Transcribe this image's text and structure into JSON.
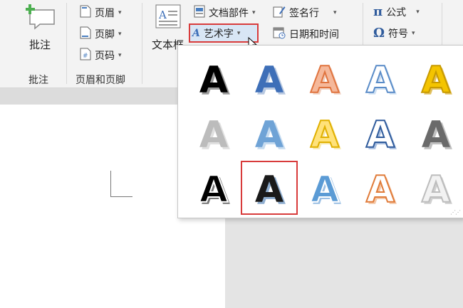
{
  "ribbon": {
    "comment_group": {
      "button_label": "批注",
      "group_label": "批注"
    },
    "header_footer_group": {
      "items": [
        {
          "label": "页眉",
          "icon": "page-header-icon"
        },
        {
          "label": "页脚",
          "icon": "page-footer-icon"
        },
        {
          "label": "页码",
          "icon": "page-number-icon"
        }
      ],
      "group_label": "页眉和页脚"
    },
    "text_group": {
      "textbox_label": "文本框",
      "doc_parts_label": "文档部件",
      "wordart_label": "艺术字",
      "signature_label": "签名行",
      "datetime_label": "日期和时间"
    },
    "symbols_group": {
      "equation_label": "公式",
      "symbol_label": "符号",
      "equation_glyph": "π",
      "symbol_glyph": "Ω"
    }
  },
  "wordart_gallery": {
    "letter": "A",
    "selected_index": 11,
    "styles": [
      {
        "fill": "#000000",
        "stroke": "none",
        "shadow": "#9a9a9a"
      },
      {
        "fill": "#3e6fb8",
        "stroke": "none",
        "shadow": "#b8c8e0"
      },
      {
        "fill": "#f5b89a",
        "stroke": "#e0743f",
        "shadow": "#f0d0c0"
      },
      {
        "fill": "#ffffff",
        "stroke": "#5a8cc8",
        "shadow": "#cfe0f2"
      },
      {
        "fill": "#f4c400",
        "stroke": "#c89a00",
        "shadow": "#e0c060"
      },
      {
        "fill": "#bcbcbc",
        "stroke": "none",
        "shadow": "#e0e0e0"
      },
      {
        "fill": "#6fa3d6",
        "stroke": "none",
        "shadow": "#c7dcf0"
      },
      {
        "fill": "#ffe27a",
        "stroke": "#e0b000",
        "shadow": "#f8eab0"
      },
      {
        "fill": "#ffffff",
        "stroke": "#2f5b9c",
        "shadow": "#aac0e0"
      },
      {
        "fill": "#6a6a6a",
        "stroke": "none",
        "shadow": "#c0c0c0"
      },
      {
        "fill": "#000000",
        "stroke": "#ffffff",
        "shadow": "#777777"
      },
      {
        "fill": "#1a1a1a",
        "stroke": "none",
        "shadow": "#8faed0"
      },
      {
        "fill": "#5b9bd5",
        "stroke": "#ffffff",
        "shadow": "#9cc0e4"
      },
      {
        "fill": "#ffffff",
        "stroke": "#e07b39",
        "shadow": "#f4c8a8"
      },
      {
        "fill": "#f2f2f2",
        "stroke": "#bdbdbd",
        "shadow": "#d0d0d0"
      }
    ]
  }
}
